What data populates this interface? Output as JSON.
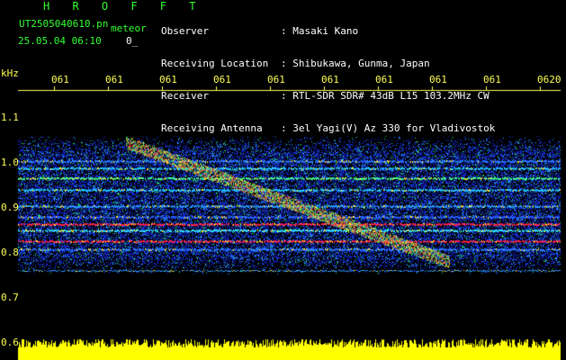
{
  "header": {
    "title": "H R O F F T",
    "filename": "UT2505040610.pn",
    "tag": "meteor",
    "date": "25.05.04 06:10",
    "counter": "0_"
  },
  "info": {
    "labels": [
      "Observer",
      "Receiving Location",
      "Receiver",
      "Receiving Antenna"
    ],
    "values": [
      ": Masaki Kano",
      ": Shibukawa, Gunma, Japan",
      ": RTL-SDR SDR# 43dB L15 103.2MHz CW",
      ": 3el Yagi(V) Az 330 for Vladivostok"
    ]
  },
  "axis": {
    "unit": "kHz",
    "y_ticks": [
      "1.1",
      "1.0",
      "0.9",
      "0.8",
      "0.7",
      "0.6"
    ],
    "time_ticks": [
      "061",
      "061",
      "061",
      "061",
      "061",
      "061",
      "061",
      "061",
      "061",
      "0620"
    ]
  },
  "colors": {
    "background": "#000000",
    "header_green": "#33ff33",
    "axis_yellow": "#ffff55",
    "noise_blue": "#1a2cff",
    "carrier_red": "#ff2244",
    "signal_band": "#ffff00"
  }
}
